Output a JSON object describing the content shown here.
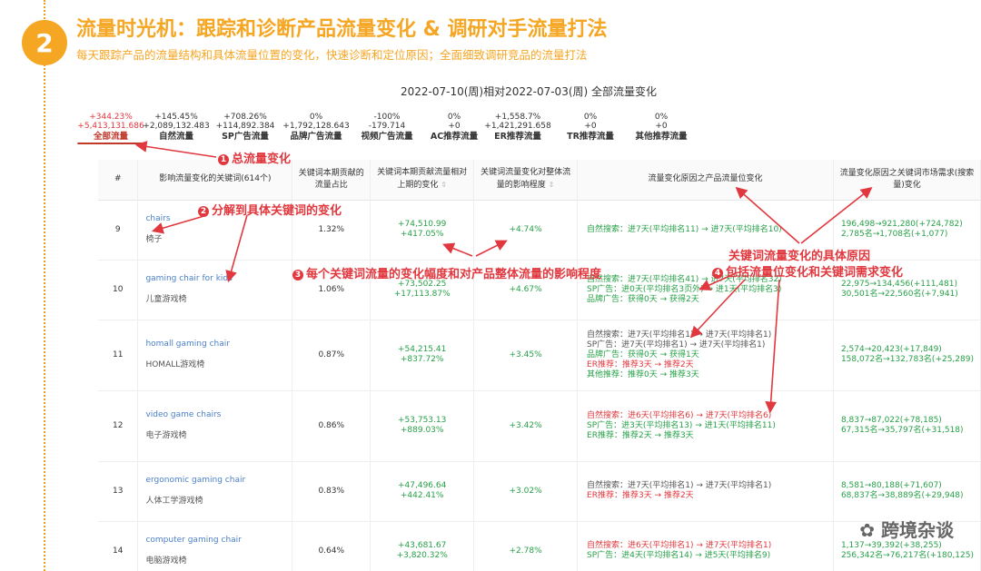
{
  "header": {
    "badge": "2",
    "title": "流量时光机：跟踪和诊断产品流量变化 & 调研对手流量打法",
    "subtitle": "每天跟踪产品的流量结构和具体流量位置的变化，快速诊断和定位原因；全面细致调研竞品的流量打法"
  },
  "period": "2022-07-10(周)相对2022-07-03(周) 全部流量变化",
  "metrics": [
    {
      "pct": "+344.23%",
      "val": "+5,413,131.686",
      "label": "全部流量"
    },
    {
      "pct": "+145.45%",
      "val": "+2,089,132.483",
      "label": "自然流量"
    },
    {
      "pct": "+708.26%",
      "val": "+114,892.384",
      "label": "SP广告流量"
    },
    {
      "pct": "0%",
      "val": "+1,792,128.643",
      "label": "品牌广告流量"
    },
    {
      "pct": "-100%",
      "val": "-179.714",
      "label": "视频广告流量"
    },
    {
      "pct": "0%",
      "val": "+0",
      "label": "AC推荐流量"
    },
    {
      "pct": "+1,558.7%",
      "val": "+1,421,291.658",
      "label": "ER推荐流量"
    },
    {
      "pct": "0%",
      "val": "+0",
      "label": "TR推荐流量"
    },
    {
      "pct": "0%",
      "val": "+0",
      "label": "其他推荐流量"
    }
  ],
  "table": {
    "headers": {
      "num": "#",
      "keyword": "影响流量变化的关键词(614个)",
      "share": "关键词本期贡献的流量占比",
      "change": "关键词本期贡献流量相对上期的变化",
      "impact": "关键词流量变化对整体流量的影响程度",
      "reason_pos": "流量变化原因之产品流量位变化",
      "reason_demand": "流量变化原因之关键词市场需求(搜索量)变化"
    },
    "rows": [
      {
        "num": "9",
        "en": "chairs",
        "cn": "椅子",
        "share": "1.32%",
        "change1": "+74,510.99",
        "change2": "+417.05%",
        "impact": "+4.74%",
        "reasons": [
          {
            "t": "自然搜索：进7天(平均排名11) → 进7天(平均排名10)",
            "c": "green"
          }
        ],
        "demand": [
          "196,498→921,280(+724,782)",
          "2,785名→1,708名(+1,077)"
        ]
      },
      {
        "num": "10",
        "en": "gaming chair for kids",
        "cn": "儿童游戏椅",
        "share": "1.06%",
        "change1": "+73,502.25",
        "change2": "+17,113.87%",
        "impact": "+4.67%",
        "reasons": [
          {
            "t": "自然搜索：进7天(平均排名41) → 进7天(平均排名32)",
            "c": "green"
          },
          {
            "t": "SP广告：进0天(平均排名3页外) → 进1天(平均排名3)",
            "c": "green"
          },
          {
            "t": "品牌广告：获得0天 → 获得2天",
            "c": "green"
          }
        ],
        "demand": [
          "22,975→134,456(+111,481)",
          "30,501名→22,560名(+7,941)"
        ]
      },
      {
        "num": "11",
        "en": "homall gaming chair",
        "cn": "HOMALL游戏椅",
        "share": "0.87%",
        "change1": "+54,215.41",
        "change2": "+837.72%",
        "impact": "+3.45%",
        "reasons": [
          {
            "t": "自然搜索：进7天(平均排名1) → 进7天(平均排名1)",
            "c": "gray"
          },
          {
            "t": "SP广告：进7天(平均排名1) → 进7天(平均排名1)",
            "c": "gray"
          },
          {
            "t": "品牌广告：获得0天 → 获得1天",
            "c": "green"
          },
          {
            "t": "ER推荐：推荐3天 → 推荐2天",
            "c": "red"
          },
          {
            "t": "其他推荐：推荐0天 → 推荐3天",
            "c": "green"
          }
        ],
        "demand": [
          "2,574→20,423(+17,849)",
          "158,072名→132,783名(+25,289)"
        ]
      },
      {
        "num": "12",
        "en": "video game chairs",
        "cn": "电子游戏椅",
        "share": "0.86%",
        "change1": "+53,753.13",
        "change2": "+889.03%",
        "impact": "+3.42%",
        "reasons": [
          {
            "t": "自然搜索：进6天(平均排名6) → 进7天(平均排名6)",
            "c": "red"
          },
          {
            "t": "SP广告：进3天(平均排名13) → 进1天(平均排名11)",
            "c": "green"
          },
          {
            "t": "ER推荐：推荐2天 → 推荐3天",
            "c": "green"
          }
        ],
        "demand": [
          "8,837→87,022(+78,185)",
          "67,315名→35,797名(+31,518)"
        ]
      },
      {
        "num": "13",
        "en": "ergonomic gaming chair",
        "cn": "人体工学游戏椅",
        "share": "0.83%",
        "change1": "+47,496.64",
        "change2": "+442.41%",
        "impact": "+3.02%",
        "reasons": [
          {
            "t": "自然搜索：进7天(平均排名1) → 进7天(平均排名1)",
            "c": "gray"
          },
          {
            "t": "ER推荐：推荐3天 → 推荐2天",
            "c": "red"
          }
        ],
        "demand": [
          "8,581→80,188(+71,607)",
          "68,837名→38,889名(+29,948)"
        ]
      },
      {
        "num": "14",
        "en": "computer gaming chair",
        "cn": "电脑游戏椅",
        "share": "0.64%",
        "change1": "+43,681.67",
        "change2": "+3,820.32%",
        "impact": "+2.78%",
        "reasons": [
          {
            "t": "自然搜索：进6天(平均排名1) → 进7天(平均排名1)",
            "c": "red"
          },
          {
            "t": "SP广告：进4天(平均排名14) → 进5天(平均排名9)",
            "c": "green"
          }
        ],
        "demand": [
          "1,137→39,392(+38,255)",
          "256,342名→76,217名(+180,125)"
        ]
      }
    ]
  },
  "notes": {
    "n1": {
      "num": "1",
      "text": "总流量变化"
    },
    "n2": {
      "num": "2",
      "text": "分解到具体关键词的变化"
    },
    "n3": {
      "num": "3",
      "text": "每个关键词流量的变化幅度和对产品整体流量的影响程度"
    },
    "n4": {
      "num": "4",
      "text1": "关键词流量变化的具体原因",
      "text2": "包括流量位变化和关键词需求变化"
    }
  },
  "watermark": "跨境杂谈",
  "colors": {
    "accent": "#f5a623",
    "red": "#e0383e",
    "green": "#27a048",
    "blue": "#4a7fc9"
  }
}
